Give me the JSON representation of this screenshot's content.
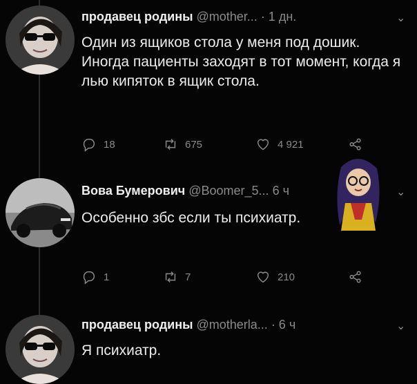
{
  "tweets": [
    {
      "author": "продавец родины",
      "handle": "@mother...",
      "time": "· 1 дн.",
      "text": "Один из ящиков стола у меня под дошик. Иногда пациенты заходят в тот момент, когда я лью кипяток в ящик стола.",
      "replies": "18",
      "retweets": "675",
      "likes": "4 921"
    },
    {
      "author": "Вова Бумерович",
      "handle": "@Boomer_5...",
      "time": "6 ч",
      "text": "Особенно збс если ты психиатр.",
      "replies": "1",
      "retweets": "7",
      "likes": "210"
    },
    {
      "author": "продавец родины",
      "handle": "@motherla...",
      "time": "· 6 ч",
      "text": "Я психиатр."
    }
  ],
  "icons": {
    "reply": "reply-icon",
    "retweet": "retweet-icon",
    "like": "heart-icon",
    "share": "share-icon",
    "menu": "chevron-down-icon"
  },
  "colors": {
    "background": "#050505",
    "text": "#ececec",
    "muted": "#8a8a8a"
  }
}
